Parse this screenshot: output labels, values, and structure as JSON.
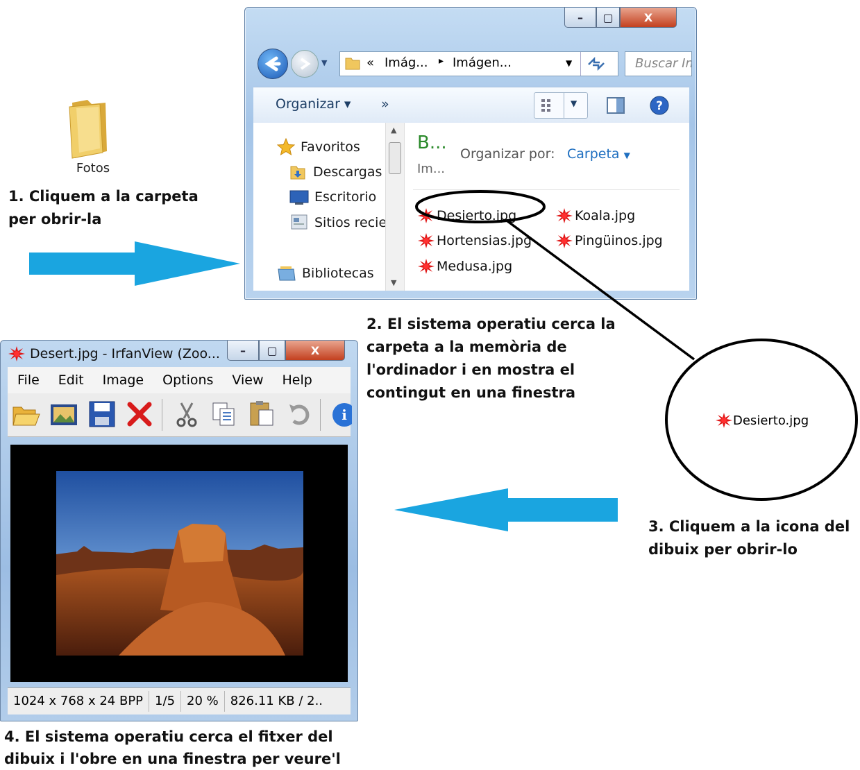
{
  "desktop": {
    "folder_label": "Fotos"
  },
  "captions": {
    "step1": [
      "1. Cliquem a la carpeta",
      "per obrir-la"
    ],
    "step2": [
      "2. El sistema operatiu cerca la",
      "carpeta a la memòria de",
      "l'ordinador i en mostra el",
      "contingut en una finestra"
    ],
    "step3": [
      "3. Cliquem a la icona del",
      "dibuix per obrir-lo"
    ],
    "step4": [
      "4. El sistema operatiu cerca el fitxer del",
      "dibuix i l'obre en una finestra per veure'l"
    ]
  },
  "explorer": {
    "window_buttons": [
      "–",
      "▢",
      "X"
    ],
    "address": {
      "prefix": "«",
      "crumb1": "Imág...",
      "separator": "▸",
      "crumb2": "Imágen..."
    },
    "search_placeholder": "Buscar Im",
    "toolbar": {
      "organize": "Organizar ▾",
      "more": "»"
    },
    "nav_items": [
      {
        "icon": "star-icon",
        "label": "Favoritos"
      },
      {
        "icon": "downloads-icon",
        "label": "Descargas"
      },
      {
        "icon": "desktop-icon",
        "label": "Escritorio"
      },
      {
        "icon": "recent-places-icon",
        "label": "Sitios recie"
      },
      {
        "icon": "libraries-icon",
        "label": "Bibliotecas"
      }
    ],
    "library_header": {
      "title": "B...",
      "subtitle": "Im...",
      "arrange_label": "Organizar por:",
      "arrange_value": "Carpeta"
    },
    "files": [
      "Desierto.jpg",
      "Koala.jpg",
      "Hortensias.jpg",
      "Pingüinos.jpg",
      "Medusa.jpg"
    ]
  },
  "zoom": {
    "file": "Desierto.jpg"
  },
  "irfanview": {
    "title": "Desert.jpg - IrfanView (Zoo...",
    "window_buttons": [
      "–",
      "▢",
      "X"
    ],
    "menu": [
      "File",
      "Edit",
      "Image",
      "Options",
      "View",
      "Help"
    ],
    "status": [
      "1024 x 768 x 24 BPP",
      "1/5",
      "20 %",
      "826.11 KB / 2.."
    ]
  },
  "colors": {
    "arrow": "#1aa5e0",
    "explorer_frame": "#a9c7e8",
    "link_blue": "#1f6fc0",
    "library_title": "#2b8a2b"
  }
}
